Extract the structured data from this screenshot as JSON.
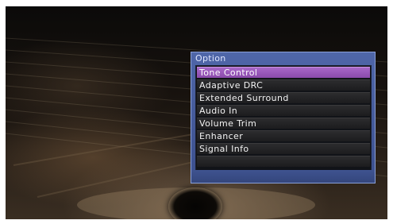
{
  "menu": {
    "title": "Option",
    "selected_index": 0,
    "items": [
      {
        "label": "Tone Control"
      },
      {
        "label": "Adaptive DRC"
      },
      {
        "label": "Extended Surround"
      },
      {
        "label": "Audio In"
      },
      {
        "label": "Volume Trim"
      },
      {
        "label": "Enhancer"
      },
      {
        "label": "Signal Info"
      },
      {
        "label": ""
      }
    ]
  },
  "colors": {
    "menu_frame": "#4f66a8",
    "selected_item": "#a867c8",
    "item_background": "#2c2c2e",
    "item_text": "#f2f2f2"
  }
}
